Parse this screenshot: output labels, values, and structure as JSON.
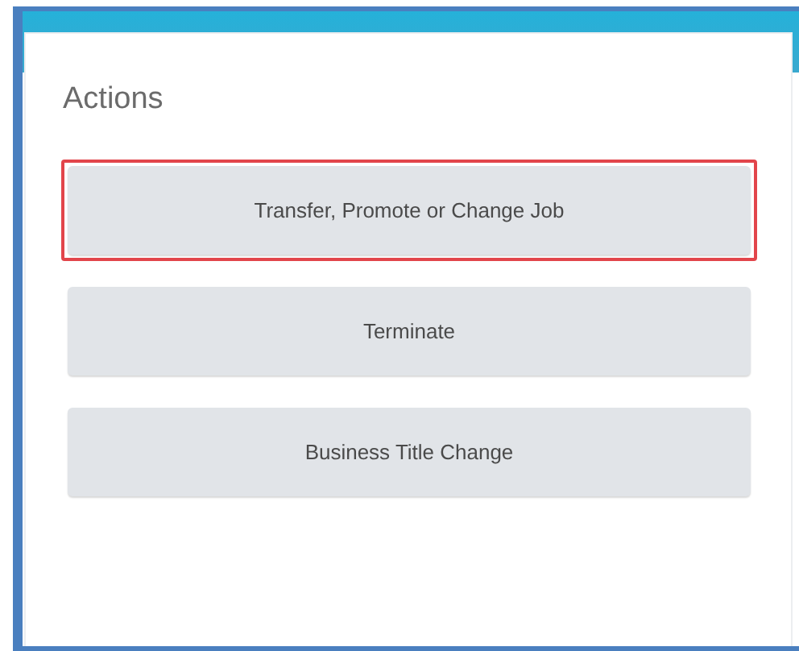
{
  "panel": {
    "title": "Actions"
  },
  "actions": [
    {
      "label": "Transfer, Promote or Change Job",
      "highlighted": true
    },
    {
      "label": "Terminate",
      "highlighted": false
    },
    {
      "label": "Business Title Change",
      "highlighted": false
    }
  ]
}
